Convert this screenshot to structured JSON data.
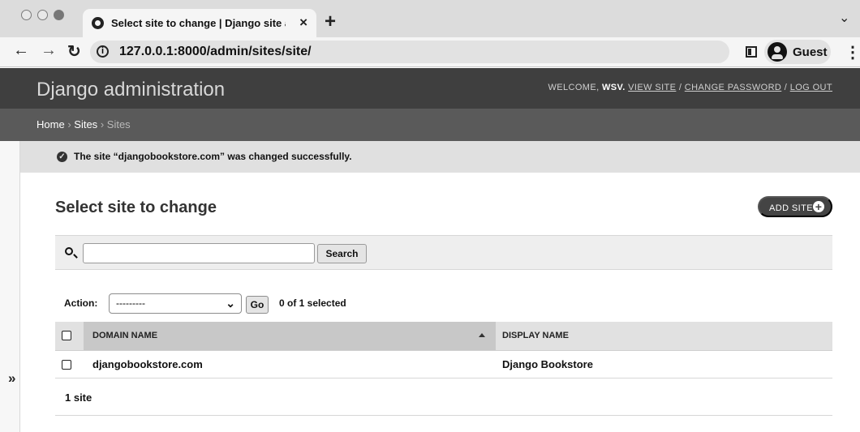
{
  "browser": {
    "tab_title": "Select site to change | Django site admin",
    "url": "127.0.0.1:8000/admin/sites/site/",
    "profile_label": "Guest"
  },
  "header": {
    "site_title": "Django administration",
    "welcome": "WELCOME,",
    "username": "WSV.",
    "view_site": "VIEW SITE",
    "slash_1": "/",
    "change_password": "CHANGE PASSWORD",
    "slash_2": "/",
    "logout": "LOG OUT"
  },
  "breadcrumbs": {
    "home": "Home",
    "separator_1": "›",
    "sites_app": "Sites",
    "separator_2": "›",
    "current": "Sites"
  },
  "messages": {
    "success": "The site “djangobookstore.com” was changed successfully."
  },
  "content": {
    "title": "Select site to change",
    "add_button": "ADD SITE",
    "add_icon": "+"
  },
  "search": {
    "value": "",
    "button": "Search"
  },
  "actions": {
    "label": "Action:",
    "selected_option": "---------",
    "go_button": "Go",
    "selection_count": "0 of 1 selected"
  },
  "table": {
    "columns": [
      "DOMAIN NAME",
      "DISPLAY NAME"
    ],
    "rows": [
      {
        "domain": "djangobookstore.com",
        "display_name": "Django Bookstore"
      }
    ]
  },
  "pagination": {
    "count": "1 site"
  },
  "sidebar": {
    "toggle_icon": "»"
  },
  "colors": {
    "header": "#3f3f3f",
    "breadcrumbs": "#5a5a5a",
    "message": "#e0e0e0"
  }
}
